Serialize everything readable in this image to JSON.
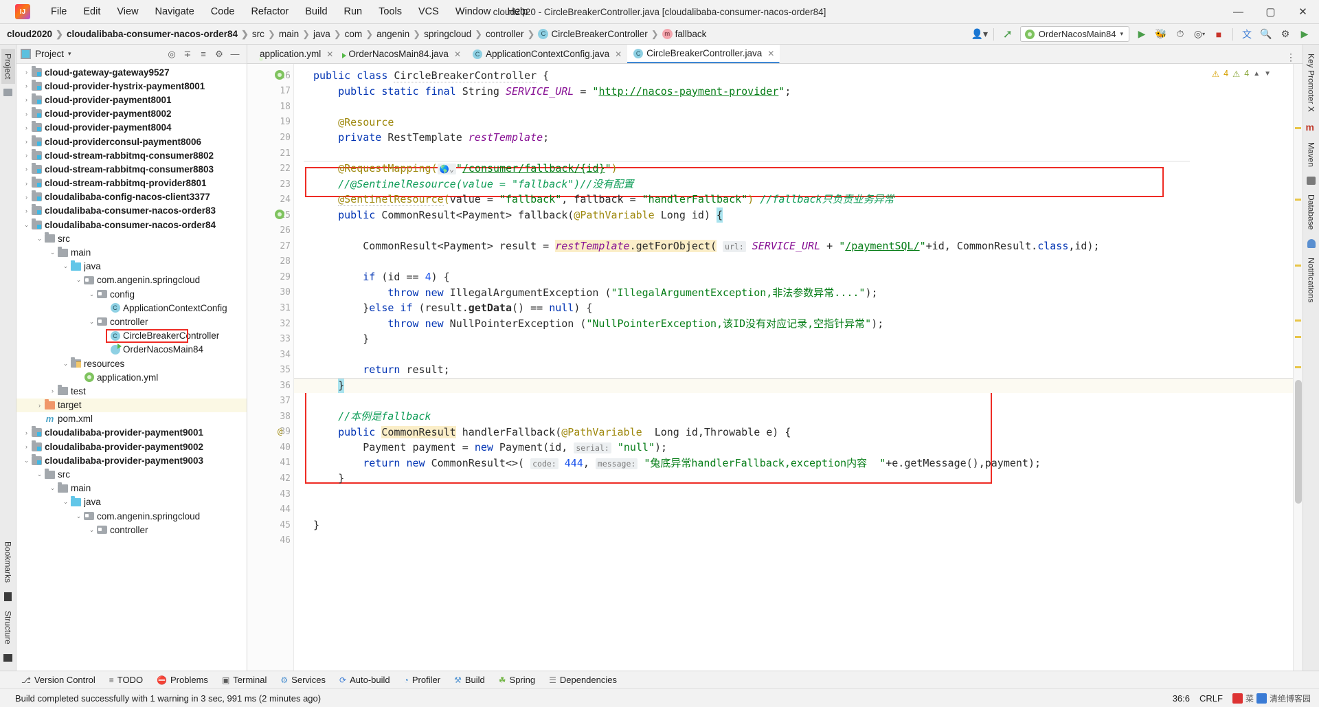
{
  "window": {
    "title": "cloud2020 - CircleBreakerController.java [cloudalibaba-consumer-nacos-order84]",
    "minimize": "—",
    "maximize": "▢",
    "close": "✕"
  },
  "menubar": [
    "File",
    "Edit",
    "View",
    "Navigate",
    "Code",
    "Refactor",
    "Build",
    "Run",
    "Tools",
    "VCS",
    "Window",
    "Help"
  ],
  "breadcrumb": [
    {
      "label": "cloud2020",
      "bold": true,
      "badge": ""
    },
    {
      "label": "cloudalibaba-consumer-nacos-order84",
      "bold": true,
      "badge": ""
    },
    {
      "label": "src",
      "bold": false,
      "badge": ""
    },
    {
      "label": "main",
      "bold": false,
      "badge": ""
    },
    {
      "label": "java",
      "bold": false,
      "badge": ""
    },
    {
      "label": "com",
      "bold": false,
      "badge": ""
    },
    {
      "label": "angenin",
      "bold": false,
      "badge": ""
    },
    {
      "label": "springcloud",
      "bold": false,
      "badge": ""
    },
    {
      "label": "controller",
      "bold": false,
      "badge": ""
    },
    {
      "label": "CircleBreakerController",
      "bold": false,
      "badge": "C"
    },
    {
      "label": "fallback",
      "bold": false,
      "badge": "m"
    }
  ],
  "toolbar": {
    "run_config": "OrderNacosMain84",
    "dropdown_caret": "▾",
    "icons": [
      "user-icon",
      "hammer-icon",
      "run-icon",
      "debug-icon",
      "profile-icon",
      "coverage-icon",
      "stop-icon",
      "translate-icon",
      "search-icon",
      "settings-icon",
      "update-icon"
    ]
  },
  "left_strip": {
    "project_tab": "Project",
    "structure_tab": "Structure",
    "bookmarks_tab": "Bookmarks"
  },
  "right_strip": {
    "items": [
      "Key Promoter X",
      "Maven",
      "Database",
      "Notifications"
    ]
  },
  "project_panel": {
    "title": "Project",
    "caret": "▾",
    "actions": [
      "target-icon",
      "expand-icon",
      "collapse-icon",
      "settings-icon",
      "hide-icon"
    ],
    "tree": [
      {
        "depth": 1,
        "arrow": "›",
        "icon": "module-folder",
        "label": "cloud-gateway-gateway9527",
        "bold": true,
        "hl": false,
        "sel": false
      },
      {
        "depth": 1,
        "arrow": "›",
        "icon": "module-folder",
        "label": "cloud-provider-hystrix-payment8001",
        "bold": true,
        "hl": false,
        "sel": false
      },
      {
        "depth": 1,
        "arrow": "›",
        "icon": "module-folder",
        "label": "cloud-provider-payment8001",
        "bold": true,
        "hl": false,
        "sel": false
      },
      {
        "depth": 1,
        "arrow": "›",
        "icon": "module-folder",
        "label": "cloud-provider-payment8002",
        "bold": true,
        "hl": false,
        "sel": false
      },
      {
        "depth": 1,
        "arrow": "›",
        "icon": "module-folder",
        "label": "cloud-provider-payment8004",
        "bold": true,
        "hl": false,
        "sel": false
      },
      {
        "depth": 1,
        "arrow": "›",
        "icon": "module-folder",
        "label": "cloud-providerconsul-payment8006",
        "bold": true,
        "hl": false,
        "sel": false
      },
      {
        "depth": 1,
        "arrow": "›",
        "icon": "module-folder",
        "label": "cloud-stream-rabbitmq-consumer8802",
        "bold": true,
        "hl": false,
        "sel": false
      },
      {
        "depth": 1,
        "arrow": "›",
        "icon": "module-folder",
        "label": "cloud-stream-rabbitmq-consumer8803",
        "bold": true,
        "hl": false,
        "sel": false
      },
      {
        "depth": 1,
        "arrow": "›",
        "icon": "module-folder",
        "label": "cloud-stream-rabbitmq-provider8801",
        "bold": true,
        "hl": false,
        "sel": false
      },
      {
        "depth": 1,
        "arrow": "›",
        "icon": "module-folder",
        "label": "cloudalibaba-config-nacos-client3377",
        "bold": true,
        "hl": false,
        "sel": false
      },
      {
        "depth": 1,
        "arrow": "›",
        "icon": "module-folder",
        "label": "cloudalibaba-consumer-nacos-order83",
        "bold": true,
        "hl": false,
        "sel": false
      },
      {
        "depth": 1,
        "arrow": "⌄",
        "icon": "module-folder",
        "label": "cloudalibaba-consumer-nacos-order84",
        "bold": true,
        "hl": false,
        "sel": false
      },
      {
        "depth": 2,
        "arrow": "⌄",
        "icon": "plain-folder",
        "label": "src",
        "bold": false,
        "hl": false,
        "sel": false
      },
      {
        "depth": 3,
        "arrow": "⌄",
        "icon": "plain-folder",
        "label": "main",
        "bold": false,
        "hl": false,
        "sel": false
      },
      {
        "depth": 4,
        "arrow": "⌄",
        "icon": "source-folder",
        "label": "java",
        "bold": false,
        "hl": false,
        "sel": false
      },
      {
        "depth": 5,
        "arrow": "⌄",
        "icon": "package",
        "label": "com.angenin.springcloud",
        "bold": false,
        "hl": false,
        "sel": false
      },
      {
        "depth": 6,
        "arrow": "⌄",
        "icon": "package",
        "label": "config",
        "bold": false,
        "hl": false,
        "sel": false
      },
      {
        "depth": 7,
        "arrow": "",
        "icon": "class",
        "label": "ApplicationContextConfig",
        "bold": false,
        "hl": false,
        "sel": false
      },
      {
        "depth": 6,
        "arrow": "⌄",
        "icon": "package",
        "label": "controller",
        "bold": false,
        "hl": false,
        "sel": false
      },
      {
        "depth": 7,
        "arrow": "",
        "icon": "class",
        "label": "CircleBreakerController",
        "bold": false,
        "hl": false,
        "sel": true
      },
      {
        "depth": 7,
        "arrow": "",
        "icon": "spring-run",
        "label": "OrderNacosMain84",
        "bold": false,
        "hl": false,
        "sel": false
      },
      {
        "depth": 4,
        "arrow": "⌄",
        "icon": "resources-folder",
        "label": "resources",
        "bold": false,
        "hl": false,
        "sel": false
      },
      {
        "depth": 5,
        "arrow": "",
        "icon": "yml",
        "label": "application.yml",
        "bold": false,
        "hl": false,
        "sel": false
      },
      {
        "depth": 3,
        "arrow": "›",
        "icon": "plain-folder",
        "label": "test",
        "bold": false,
        "hl": false,
        "sel": false
      },
      {
        "depth": 2,
        "arrow": "›",
        "icon": "target-folder",
        "label": "target",
        "bold": false,
        "hl": true,
        "sel": false
      },
      {
        "depth": 2,
        "arrow": "",
        "icon": "maven",
        "label": "pom.xml",
        "bold": false,
        "hl": false,
        "sel": false
      },
      {
        "depth": 1,
        "arrow": "›",
        "icon": "module-folder",
        "label": "cloudalibaba-provider-payment9001",
        "bold": true,
        "hl": false,
        "sel": false
      },
      {
        "depth": 1,
        "arrow": "›",
        "icon": "module-folder",
        "label": "cloudalibaba-provider-payment9002",
        "bold": true,
        "hl": false,
        "sel": false
      },
      {
        "depth": 1,
        "arrow": "⌄",
        "icon": "module-folder",
        "label": "cloudalibaba-provider-payment9003",
        "bold": true,
        "hl": false,
        "sel": false
      },
      {
        "depth": 2,
        "arrow": "⌄",
        "icon": "plain-folder",
        "label": "src",
        "bold": false,
        "hl": false,
        "sel": false
      },
      {
        "depth": 3,
        "arrow": "⌄",
        "icon": "plain-folder",
        "label": "main",
        "bold": false,
        "hl": false,
        "sel": false
      },
      {
        "depth": 4,
        "arrow": "⌄",
        "icon": "source-folder",
        "label": "java",
        "bold": false,
        "hl": false,
        "sel": false
      },
      {
        "depth": 5,
        "arrow": "⌄",
        "icon": "package",
        "label": "com.angenin.springcloud",
        "bold": false,
        "hl": false,
        "sel": false
      },
      {
        "depth": 6,
        "arrow": "⌄",
        "icon": "package",
        "label": "controller",
        "bold": false,
        "hl": false,
        "sel": false
      }
    ]
  },
  "editor": {
    "tabs": [
      {
        "label": "application.yml",
        "icon": "yml-icon",
        "active": false
      },
      {
        "label": "OrderNacosMain84.java",
        "icon": "spring-icon",
        "active": false
      },
      {
        "label": "ApplicationContextConfig.java",
        "icon": "class-icon",
        "active": false
      },
      {
        "label": "CircleBreakerController.java",
        "icon": "class-icon",
        "active": true
      }
    ],
    "first_line_number": 16,
    "lines": [
      {
        "n": 16,
        "text": "public class CircleBreakerController {"
      },
      {
        "n": 17,
        "text": "    public static final String SERVICE_URL = \"http://nacos-payment-provider\";"
      },
      {
        "n": 18,
        "text": ""
      },
      {
        "n": 19,
        "text": "    @Resource"
      },
      {
        "n": 20,
        "text": "    private RestTemplate restTemplate;"
      },
      {
        "n": 21,
        "text": ""
      },
      {
        "n": 22,
        "text": "    @RequestMapping(\"/consumer/fallback/{id}\")"
      },
      {
        "n": 23,
        "text": "    //@SentinelResource(value = \"fallback\")//没有配置"
      },
      {
        "n": 24,
        "text": "    @SentinelResource(value = \"fallback\", fallback = \"handlerFallback\") //fallback只负责业务异常"
      },
      {
        "n": 25,
        "text": "    public CommonResult<Payment> fallback(@PathVariable Long id) {"
      },
      {
        "n": 26,
        "text": ""
      },
      {
        "n": 27,
        "text": "        CommonResult<Payment> result = restTemplate.getForObject( url: SERVICE_URL + \"/paymentSQL/\"+id, CommonResult.class,id);"
      },
      {
        "n": 28,
        "text": ""
      },
      {
        "n": 29,
        "text": "        if (id == 4) {"
      },
      {
        "n": 30,
        "text": "            throw new IllegalArgumentException (\"IllegalArgumentException,非法参数异常....\");"
      },
      {
        "n": 31,
        "text": "        }else if (result.getData() == null) {"
      },
      {
        "n": 32,
        "text": "            throw new NullPointerException (\"NullPointerException,该ID没有对应记录,空指针异常\");"
      },
      {
        "n": 33,
        "text": "        }"
      },
      {
        "n": 34,
        "text": ""
      },
      {
        "n": 35,
        "text": "        return result;"
      },
      {
        "n": 36,
        "text": "    }"
      },
      {
        "n": 37,
        "text": ""
      },
      {
        "n": 38,
        "text": "    //本例是fallback"
      },
      {
        "n": 39,
        "text": "    public CommonResult handlerFallback(@PathVariable  Long id,Throwable e) {"
      },
      {
        "n": 40,
        "text": "        Payment payment = new Payment(id,  serial: \"null\");"
      },
      {
        "n": 41,
        "text": "        return new CommonResult<>( code: 444,  message: \"兜底异常handlerFallback,exception内容  \"+e.getMessage(),payment);"
      },
      {
        "n": 42,
        "text": "    }"
      },
      {
        "n": 43,
        "text": ""
      },
      {
        "n": 44,
        "text": ""
      },
      {
        "n": 45,
        "text": "}"
      },
      {
        "n": 46,
        "text": ""
      }
    ],
    "inspection": {
      "warnings": "4",
      "weak_warnings": "4",
      "warn_icon": "⚠",
      "weak_icon": "⚠"
    }
  },
  "tool_windows": [
    {
      "label": "Version Control",
      "icon": "branch-icon"
    },
    {
      "label": "TODO",
      "icon": "list-icon"
    },
    {
      "label": "Problems",
      "icon": "error-icon"
    },
    {
      "label": "Terminal",
      "icon": "terminal-icon"
    },
    {
      "label": "Services",
      "icon": "services-icon"
    },
    {
      "label": "Auto-build",
      "icon": "refresh-icon"
    },
    {
      "label": "Profiler",
      "icon": "gauge-icon"
    },
    {
      "label": "Build",
      "icon": "hammer-icon"
    },
    {
      "label": "Spring",
      "icon": "leaf-icon"
    },
    {
      "label": "Dependencies",
      "icon": "layers-icon"
    }
  ],
  "statusbar": {
    "message": "Build completed successfully with 1 warning in 3 sec, 991 ms (2 minutes ago)",
    "caret": "36:6",
    "line_sep": "CRLF",
    "watermark1": "菜",
    "watermark2": "清绝博客园"
  }
}
